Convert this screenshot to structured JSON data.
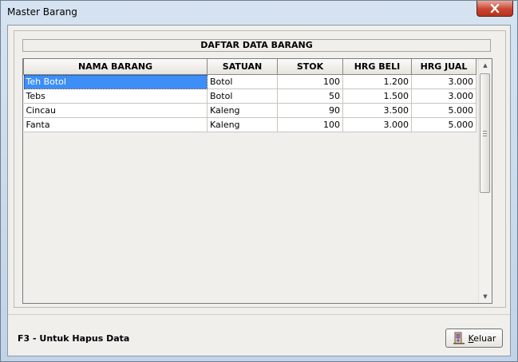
{
  "window": {
    "title": "Master Barang",
    "close_icon": "close-icon"
  },
  "list": {
    "title": "DAFTAR DATA BARANG",
    "columns": [
      "NAMA BARANG",
      "SATUAN",
      "STOK",
      "HRG BELI",
      "HRG JUAL"
    ],
    "rows": [
      {
        "nama": "Teh Botol",
        "satuan": "Botol",
        "stok": "100",
        "beli": "1.200",
        "jual": "3.000"
      },
      {
        "nama": "Tebs",
        "satuan": "Botol",
        "stok": "50",
        "beli": "1.500",
        "jual": "3.000"
      },
      {
        "nama": "Cincau",
        "satuan": "Kaleng",
        "stok": "90",
        "beli": "3.500",
        "jual": "5.000"
      },
      {
        "nama": "Fanta",
        "satuan": "Kaleng",
        "stok": "100",
        "beli": "3.000",
        "jual": "5.000"
      }
    ],
    "selected_row": 0
  },
  "footer": {
    "hint": "F3 - Untuk Hapus Data",
    "exit_label": "Keluar",
    "exit_icon": "door-exit-icon"
  }
}
